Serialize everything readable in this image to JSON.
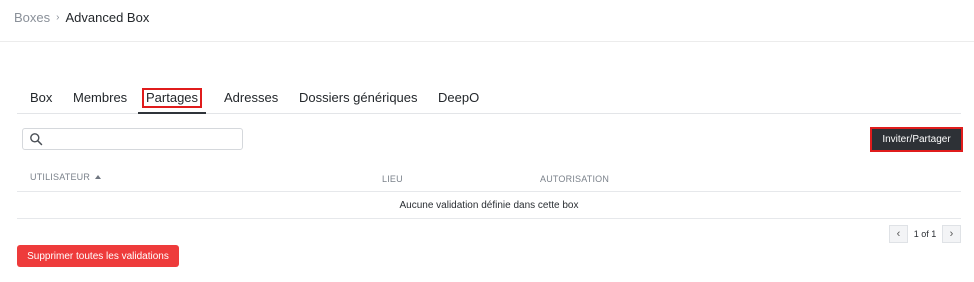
{
  "breadcrumb": {
    "root": "Boxes",
    "separator": "›",
    "current": "Advanced Box"
  },
  "tabs": [
    {
      "label": "Box"
    },
    {
      "label": "Membres"
    },
    {
      "label": "Partages",
      "active": true
    },
    {
      "label": "Adresses"
    },
    {
      "label": "Dossiers génériques"
    },
    {
      "label": "DeepO"
    }
  ],
  "search": {
    "icon": "search-icon",
    "value": "",
    "placeholder": ""
  },
  "actions": {
    "invite_label": "Inviter/Partager",
    "delete_all_label": "Supprimer toutes les validations"
  },
  "table": {
    "columns": [
      {
        "label": "UTILISATEUR",
        "sorted": "asc"
      },
      {
        "label": "LIEU"
      },
      {
        "label": "AUTORISATION"
      }
    ],
    "empty_message": "Aucune validation définie dans cette box"
  },
  "pagination": {
    "prev": "‹",
    "next": "›",
    "text": "1 of 1"
  },
  "colors": {
    "highlight": "#e01c1c",
    "dark_button": "#2d3136",
    "danger_button": "#ee3b3b"
  }
}
